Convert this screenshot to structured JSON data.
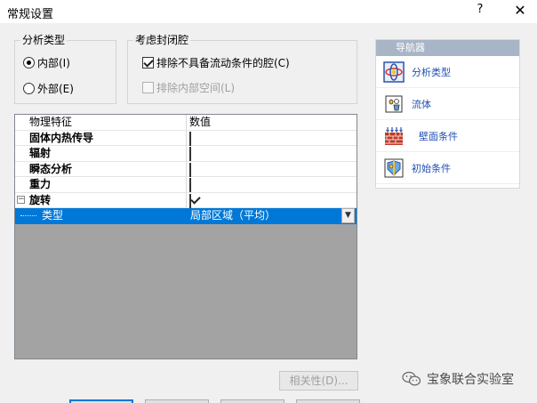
{
  "window": {
    "title": "常规设置",
    "help_label": "?",
    "close_label": "✕"
  },
  "analysis_type": {
    "title": "分析类型",
    "options": [
      {
        "label": "内部(I)",
        "selected": true
      },
      {
        "label": "外部(E)",
        "selected": false
      }
    ]
  },
  "cavity": {
    "title": "考虑封闭腔",
    "options": [
      {
        "label": "排除不具备流动条件的腔(C)",
        "checked": true,
        "enabled": true
      },
      {
        "label": "排除内部空间(L)",
        "checked": false,
        "enabled": false
      }
    ]
  },
  "grid": {
    "headers": [
      "物理特征",
      "数值"
    ],
    "rows": [
      {
        "label": "固体内热传导",
        "checked": false
      },
      {
        "label": "辐射",
        "checked": false
      },
      {
        "label": "瞬态分析",
        "checked": false
      },
      {
        "label": "重力",
        "checked": false
      },
      {
        "label": "旋转",
        "checked": true,
        "expander": "−"
      }
    ],
    "selected_row": {
      "label": "类型",
      "value": "局部区域（平均）"
    }
  },
  "nav": {
    "header": "导航器",
    "items": [
      {
        "label": "分析类型",
        "icon": "analysis-type-icon"
      },
      {
        "label": "流体",
        "icon": "fluid-icon"
      },
      {
        "label": "壁面条件",
        "icon": "wall-condition-icon"
      },
      {
        "label": "初始条件",
        "icon": "initial-condition-icon"
      }
    ]
  },
  "buttons": {
    "related": "相关性(D)..."
  },
  "watermark": {
    "text": "宝象联合实验室"
  },
  "colors": {
    "selection": "#0078d7",
    "nav_header": "#a8b5c6",
    "grid_empty": "#a3a3a3"
  }
}
